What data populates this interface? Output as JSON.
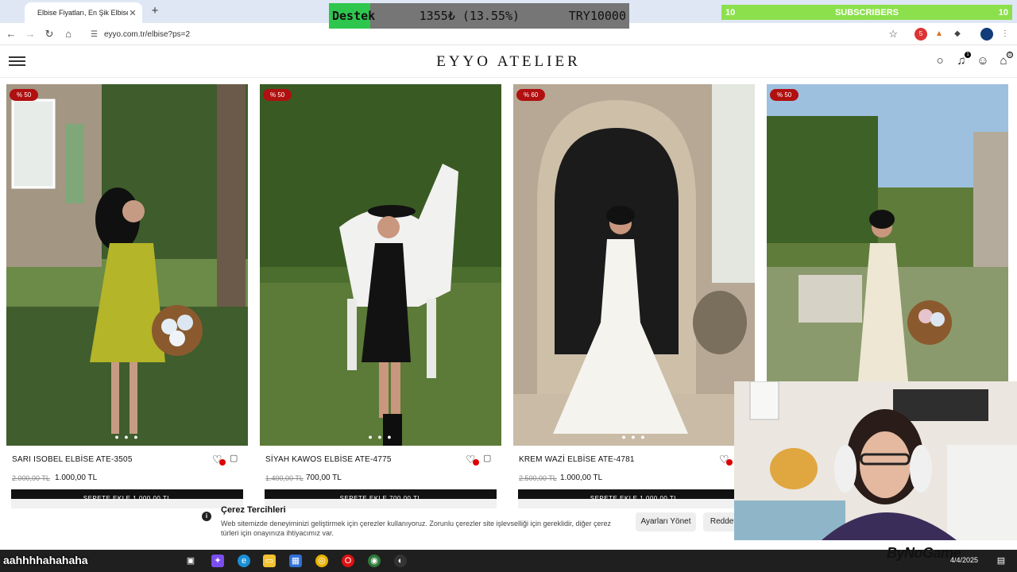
{
  "browser": {
    "tab_title": "Elbise Fiyatları, En Şik Elbise Mo",
    "url": "eyyo.com.tr/elbise?ps=2",
    "extension_badge": "5"
  },
  "overlay": {
    "goal_label": "Destek",
    "goal_progress": "1355₺ (13.55%)",
    "goal_fraction": 0.1355,
    "goal_target": "TRY10000",
    "subs_left": "10",
    "subs_label": "SUBSCRIBERS",
    "subs_right": "10"
  },
  "site": {
    "logo": "EYYO ATELIER",
    "notification_count": "1",
    "cart_count": "0"
  },
  "products": [
    {
      "discount": "% 50",
      "name": "SARI ISOBEL ELBİSE ATE-3505",
      "old_price": "2.000,00 TL",
      "price": "1.000,00 TL",
      "cta": "SEPETE EKLE 1.000,00 TL",
      "dots": "● ● ●"
    },
    {
      "discount": "% 50",
      "name": "SİYAH KAWOS ELBİSE ATE-4775",
      "old_price": "1.400,00 TL",
      "price": "700,00 TL",
      "cta": "SEPETE EKLE 700,00 TL",
      "dots": "● ● ●"
    },
    {
      "discount": "% 60",
      "name": "KREM WAZİ ELBİSE ATE-4781",
      "old_price": "2.500,00 TL",
      "price": "1.000,00 TL",
      "cta": "SEPETE EKLE 1.000,00 TL",
      "dots": "● ● ●"
    },
    {
      "discount": "% 50"
    }
  ],
  "cookie": {
    "title": "Çerez Tercihleri",
    "text": "Web sitemizde deneyiminizi geliştirmek için çerezler kullanıyoruz. Zorunlu çerezler site işlevselliği için gereklidir, diğer çerez türleri için onayınıza ihtiyacımız var.",
    "manage_label": "Ayarları Yönet",
    "reject_label": "Reddet"
  },
  "stream": {
    "chat_message": "aahhhhahahaha",
    "watermark": "ByNoGame"
  },
  "taskbar": {
    "date": "4/4/2025"
  }
}
